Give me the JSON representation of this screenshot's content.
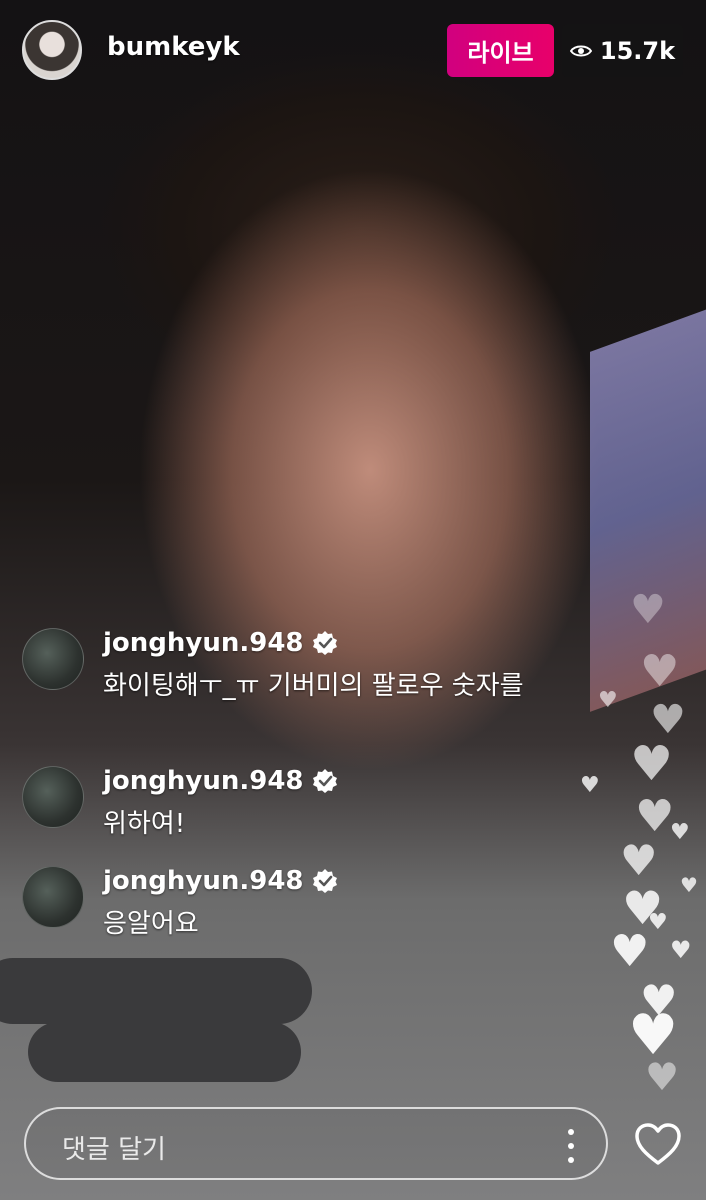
{
  "header": {
    "username": "bumkeyk",
    "live_label": "라이브",
    "viewer_count": "15.7k"
  },
  "comments": [
    {
      "user": "jonghyun.948",
      "text": "화이팅해ㅜ_ㅠ 기버미의 팔로우 숫자를"
    },
    {
      "user": "jonghyun.948",
      "text": "위하여!"
    },
    {
      "user": "jonghyun.948",
      "text": "응알어요"
    }
  ],
  "comment_box": {
    "placeholder": "댓글 달기"
  },
  "icons": {
    "eye": "eye-icon",
    "verified": "verified-badge-icon",
    "more": "more-vertical-icon",
    "like": "heart-outline-icon"
  },
  "colors": {
    "live": "#d6007a",
    "verified": "#ffffff"
  }
}
